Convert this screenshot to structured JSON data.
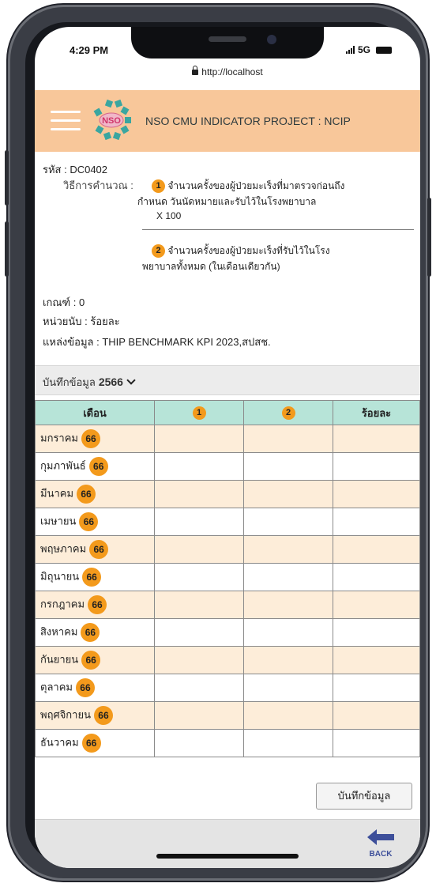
{
  "status": {
    "time": "4:29 PM",
    "network": "5G"
  },
  "browser": {
    "url": "http://localhost"
  },
  "header": {
    "title": "NSO CMU INDICATOR PROJECT : NCIP",
    "logo_text": "NSO"
  },
  "indicator": {
    "code": "รหัส : DC0402",
    "calc_label": "วิธีการคำนวณ :",
    "numerator_marker": "1",
    "numerator_line1": "จำนวนครั้งของผู้ป่วยมะเร็งที่มาตรวจก่อนถึง",
    "numerator_line2": "กำหนด วันนัดหมายและรับไว้ในโรงพยาบาล",
    "multiplier": "X 100",
    "denominator_marker": "2",
    "denominator_line1": "จำนวนครั้งของผู้ป่วยมะเร็งที่รับไว้ในโรง",
    "denominator_line2": "พยาบาลทั้งหมด (ในเดือนเดียวกัน)",
    "criteria": "เกณฑ์ : 0",
    "unit": "หน่วยนับ : ร้อยละ",
    "source": "แหล่งข้อมูล : THIP BENCHMARK KPI 2023,สปสช."
  },
  "year_selector": {
    "label": "บันทึกข้อมูล",
    "value": "2566"
  },
  "table": {
    "headers": {
      "month": "เดือน",
      "col1": "1",
      "col2": "2",
      "col3": "ร้อยละ"
    },
    "rows": [
      {
        "month": "มกราคม",
        "year": "66"
      },
      {
        "month": "กุมภาพันธ์",
        "year": "66"
      },
      {
        "month": "มีนาคม",
        "year": "66"
      },
      {
        "month": "เมษายน",
        "year": "66"
      },
      {
        "month": "พฤษภาคม",
        "year": "66"
      },
      {
        "month": "มิถุนายน",
        "year": "66"
      },
      {
        "month": "กรกฎาคม",
        "year": "66"
      },
      {
        "month": "สิงหาคม",
        "year": "66"
      },
      {
        "month": "กันยายน",
        "year": "66"
      },
      {
        "month": "ตุลาคม",
        "year": "66"
      },
      {
        "month": "พฤศจิกายน",
        "year": "66"
      },
      {
        "month": "ธันวาคม",
        "year": "66"
      }
    ]
  },
  "actions": {
    "save_label": "บันทึกข้อมูล",
    "back_label": "BACK"
  },
  "colors": {
    "header_bg": "#f8c79a",
    "table_header_bg": "#b7e4d8",
    "row_alt_bg": "#fdedd9",
    "badge": "#f39a1c"
  }
}
